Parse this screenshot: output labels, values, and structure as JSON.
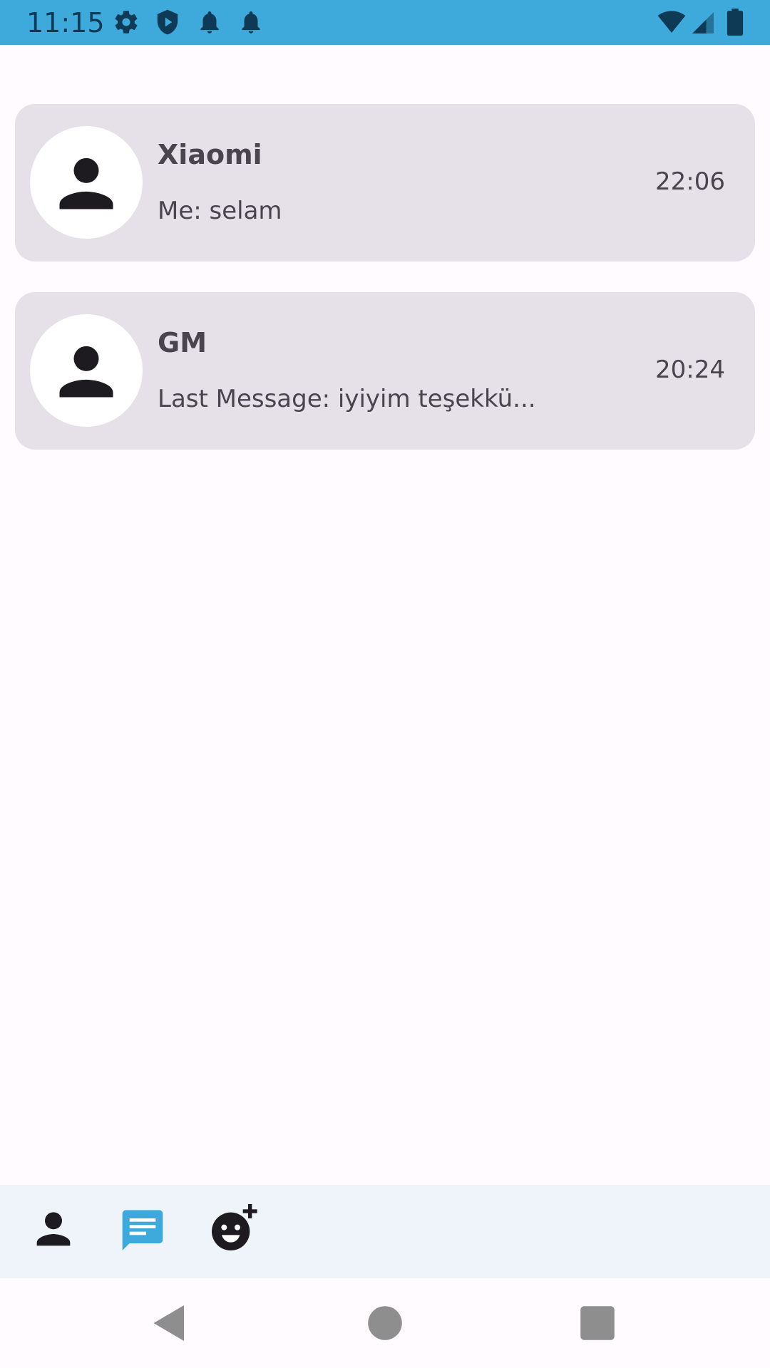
{
  "status_bar": {
    "time": "11:15",
    "icons": [
      "settings-icon",
      "shield-play-icon",
      "notification-bell-icon",
      "notification-bell-icon",
      "wifi-icon",
      "cellular-signal-icon",
      "battery-icon"
    ],
    "background": "#3eaadb"
  },
  "chats": [
    {
      "name": "Xiaomi",
      "last_message": "Me: selam",
      "time": "22:06",
      "avatar_icon": "person-icon"
    },
    {
      "name": "GM",
      "last_message": "Last Message: iyiyim teşekkü...",
      "time": "20:24",
      "avatar_icon": "person-icon"
    }
  ],
  "bottom_nav": {
    "items": [
      {
        "icon": "person-icon",
        "selected": false
      },
      {
        "icon": "chat-icon",
        "selected": true
      },
      {
        "icon": "add-friend-emoji-icon",
        "selected": false
      }
    ],
    "selected_color": "#3eaadb"
  },
  "system_nav": {
    "items": [
      "back-icon",
      "home-icon",
      "recents-icon"
    ]
  },
  "colors": {
    "card": "#e6e0e9",
    "text": "#49454f",
    "background": "#fffbfe"
  }
}
